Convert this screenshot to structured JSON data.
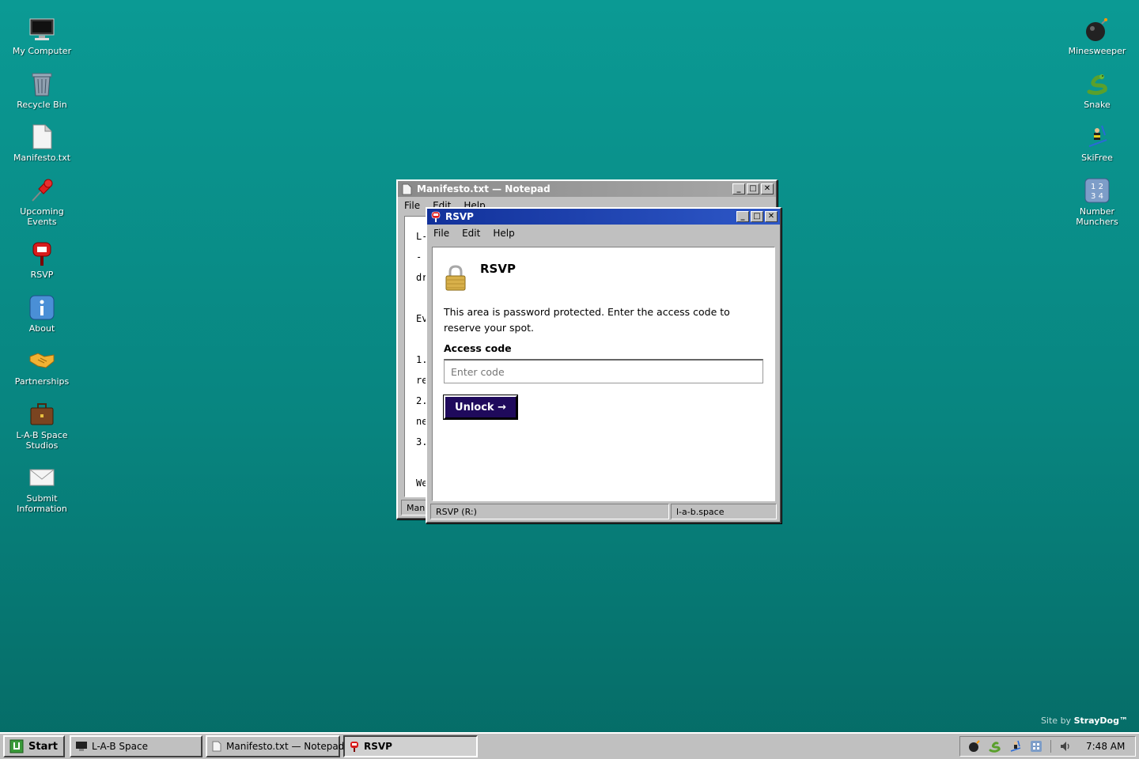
{
  "desktop_left": [
    {
      "label": "My Computer",
      "icon": "monitor-icon"
    },
    {
      "label": "Recycle Bin",
      "icon": "recycle-bin-icon"
    },
    {
      "label": "Manifesto.txt",
      "icon": "text-file-icon"
    },
    {
      "label": "Upcoming\nEvents",
      "icon": "pushpin-icon"
    },
    {
      "label": "RSVP",
      "icon": "mailbox-icon"
    },
    {
      "label": "About",
      "icon": "info-icon"
    },
    {
      "label": "Partnerships",
      "icon": "handshake-icon"
    },
    {
      "label": "L-A-B Space\nStudios",
      "icon": "briefcase-icon"
    },
    {
      "label": "Submit\nInformation",
      "icon": "envelope-icon"
    }
  ],
  "desktop_right": [
    {
      "label": "Minesweeper",
      "icon": "bomb-icon"
    },
    {
      "label": "Snake",
      "icon": "snake-icon"
    },
    {
      "label": "SkiFree",
      "icon": "skier-icon"
    },
    {
      "label": "Number\nMunchers",
      "icon": "number-tiles-icon"
    }
  ],
  "notepad": {
    "title": "Manifesto.txt — Notepad",
    "menu": [
      "File",
      "Edit",
      "Help"
    ],
    "lines": [
      "L-",
      "-",
      "dr",
      "",
      "Ev",
      "",
      "1.",
      "re",
      "2.",
      "ne",
      "3.",
      "",
      "We"
    ],
    "status": "Mani"
  },
  "rsvp": {
    "title": "RSVP",
    "menu": [
      "File",
      "Edit",
      "Help"
    ],
    "heading": "RSVP",
    "description": "This area is password protected. Enter the access code to reserve your spot.",
    "field_label": "Access code",
    "field_placeholder": "Enter code",
    "field_value": "",
    "button_label": "Unlock →",
    "status_left": "RSVP (R:)",
    "status_right": "l-a-b.space"
  },
  "credit": {
    "prefix": "Site by ",
    "brand": "StrayDog™"
  },
  "taskbar": {
    "start": "Start",
    "items": [
      {
        "label": "L-A-B Space",
        "icon": "monitor-icon",
        "active": false
      },
      {
        "label": "Manifesto.txt — Notepad",
        "icon": "text-file-icon",
        "active": false
      },
      {
        "label": "RSVP",
        "icon": "mailbox-icon",
        "active": true
      }
    ],
    "clock": "7:48 AM"
  },
  "colors": {
    "desktop": "#0b9a94",
    "active_title": "#1e3fa8",
    "inactive_title": "#8a8a8a",
    "unlock_button": "#1f0a5c"
  }
}
